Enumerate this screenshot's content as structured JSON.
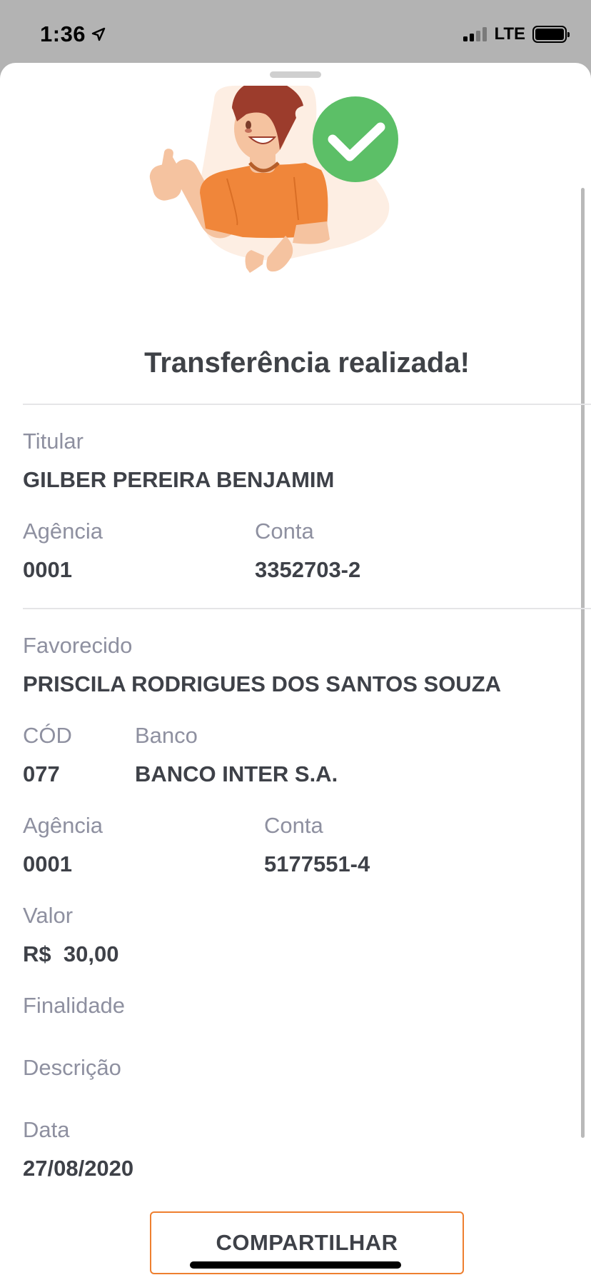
{
  "status_bar": {
    "time": "1:36",
    "network": "LTE",
    "icons": [
      "location-arrow-icon",
      "signal-icon",
      "battery-icon"
    ]
  },
  "receipt": {
    "title": "Transferência realizada!",
    "illustration": "person-thumbs-up-with-check-icon",
    "colors": {
      "check": "#5cbf67",
      "shirt": "#f0863a",
      "hair": "#9c3c2c",
      "skin": "#f5c3a0",
      "blob": "#fdeee3",
      "button_border": "#ee7f2f"
    },
    "sender": {
      "holder_label": "Titular",
      "holder_value": "GILBER PEREIRA BENJAMIM",
      "agency_label": "Agência",
      "agency_value": "0001",
      "account_label": "Conta",
      "account_value": "3352703-2"
    },
    "recipient": {
      "payee_label": "Favorecido",
      "payee_value": "PRISCILA RODRIGUES DOS SANTOS SOUZA",
      "code_label": "CÓD",
      "code_value": "077",
      "bank_label": "Banco",
      "bank_value": "BANCO INTER S.A.",
      "agency_label": "Agência",
      "agency_value": "0001",
      "account_label": "Conta",
      "account_value": "5177551-4"
    },
    "amount_label": "Valor",
    "amount_value": "R$  30,00",
    "purpose_label": "Finalidade",
    "description_label": "Descrição",
    "date_label": "Data",
    "date_value": "27/08/2020",
    "share_button": "COMPARTILHAR"
  }
}
